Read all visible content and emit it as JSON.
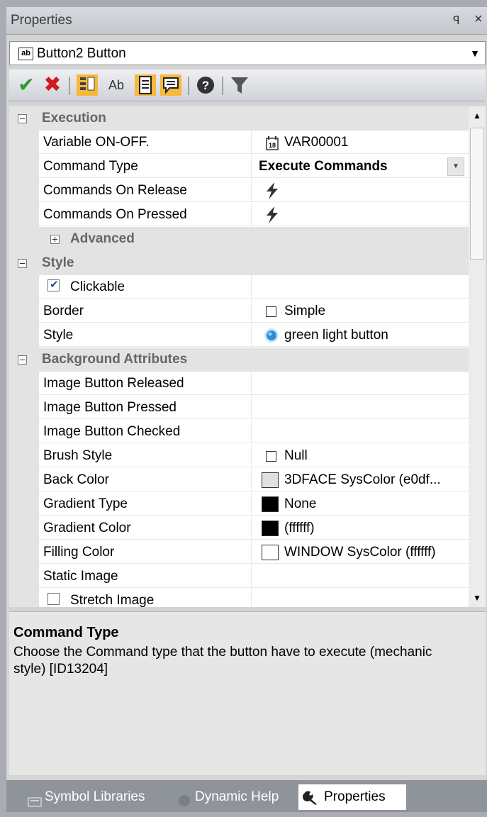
{
  "window": {
    "title": "Properties",
    "pin_glyph": "ꟼ",
    "close_glyph": "×"
  },
  "object_selector": {
    "badge": "ab",
    "value": "Button2 Button",
    "dropdown_glyph": "▼"
  },
  "toolbar": {
    "check_glyph": "✔",
    "cross_glyph": "✖",
    "sort_az_glyph": "Ab",
    "help_glyph": "?",
    "filter_glyph": "▼",
    "colors": {
      "check": "#2e9a2e",
      "cross": "#d21b1b",
      "highlight": "#f6b73c"
    }
  },
  "grid": {
    "execution": {
      "title": "Execution",
      "variable": {
        "label": "Variable ON-OFF.",
        "value": "VAR00001"
      },
      "command_type": {
        "label": "Command Type",
        "value": "Execute Commands"
      },
      "commands_release": {
        "label": "Commands On Release"
      },
      "commands_pressed": {
        "label": "Commands On Pressed"
      },
      "advanced": {
        "title": "Advanced"
      }
    },
    "style": {
      "title": "Style",
      "clickable": {
        "label": "Clickable",
        "checked": true
      },
      "border": {
        "label": "Border",
        "value": "Simple"
      },
      "style_prop": {
        "label": "Style",
        "value": "green light button"
      }
    },
    "background": {
      "title": "Background Attributes",
      "img_released": {
        "label": "Image Button Released"
      },
      "img_pressed": {
        "label": "Image Button Pressed"
      },
      "img_checked": {
        "label": "Image Button Checked"
      },
      "brush_style": {
        "label": "Brush Style",
        "value": "Null"
      },
      "back_color": {
        "label": "Back Color",
        "value": "3DFACE SysColor (e0df...",
        "swatch": "#e0dfe3"
      },
      "gradient_type": {
        "label": "Gradient Type",
        "value": "None",
        "swatch": "#000000"
      },
      "gradient_color": {
        "label": "Gradient Color",
        "value": "(ffffff)",
        "swatch": "#000000"
      },
      "filling_color": {
        "label": "Filling Color",
        "value": "WINDOW SysColor (ffffff)",
        "swatch": "#ffffff"
      },
      "static_image": {
        "label": "Static Image"
      },
      "stretch_image": {
        "label": "Stretch Image",
        "checked": false
      }
    }
  },
  "scrollbar": {
    "up_glyph": "▲",
    "down_glyph": "▼"
  },
  "description": {
    "title": "Command Type",
    "body": "Choose the Command type that the button have to execute (mechanic style) [ID13204]"
  },
  "tabs": {
    "symbol_libraries": "Symbol Libraries",
    "dynamic_help": "Dynamic Help",
    "properties": "Properties"
  }
}
